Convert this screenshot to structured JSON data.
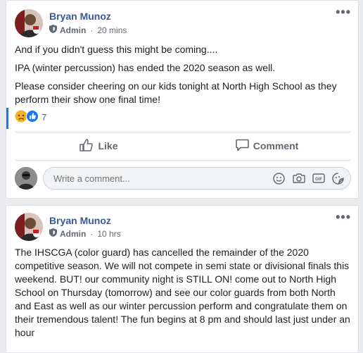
{
  "posts": [
    {
      "author": "Bryan Munoz",
      "role": "Admin",
      "time": "20 mins",
      "paragraphs": [
        "And if you didn't guess this might be coming....",
        "IPA (winter percussion) has ended the 2020 season as well.",
        "Please consider cheering on our kids tonight at North High School as they perform their show one final time!"
      ],
      "reaction_count": "7",
      "actions": {
        "like": "Like",
        "comment": "Comment"
      },
      "comment_placeholder": "Write a comment..."
    },
    {
      "author": "Bryan Munoz",
      "role": "Admin",
      "time": "10 hrs",
      "paragraphs": [
        "The IHSCGA (color guard) has cancelled the remainder of the 2020 competitive season. We will not compete in semi state or divisional finals this weekend. BUT! our community night is STILL ON! come out to North High School on Thursday (tomorrow) and see our color guards from both North and East as well as our winter percussion perform and congratulate them on their tremendous talent! The fun begins at 8 pm and should last just under an hour"
      ]
    }
  ],
  "more_icon": "ellipsis-icon",
  "colors": {
    "author": "#385898",
    "link_blue": "#1877f2"
  }
}
